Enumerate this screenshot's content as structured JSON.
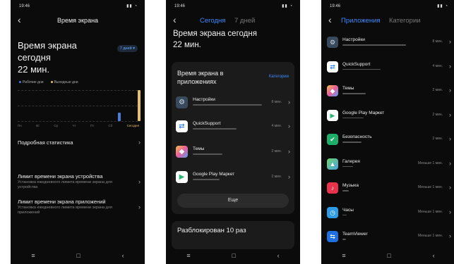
{
  "screen1": {
    "time": "19:46",
    "title": "Время экрана",
    "headline_lines": [
      "Время экрана",
      "сегодня",
      "22 мин."
    ],
    "period_pill": "7 дней ▾",
    "legend_workdays": "Рабочие дни",
    "legend_weekend": "Выходные дни",
    "chart_days": [
      "Пн",
      "Вт",
      "Ср",
      "Чт",
      "Пт",
      "Сб",
      "Сегодня"
    ],
    "chart_data": {
      "type": "bar",
      "categories": [
        "Пн",
        "Вт",
        "Ср",
        "Чт",
        "Пт",
        "Сб",
        "Сегодня"
      ],
      "values": [
        0,
        0,
        0,
        0,
        0,
        6,
        22
      ],
      "colors": [
        "#4a7bd6",
        "#e6c068"
      ]
    },
    "detailed_stats": "Подробная статистика",
    "device_limit_title": "Лимит времени экрана устройства",
    "device_limit_sub": "Установка ежедневного лимита времени экрана для устройства",
    "app_limit_title": "Лимит времени экрана приложений",
    "app_limit_sub": "Установка ежедневного лимита времени экрана для приложений"
  },
  "screen2": {
    "time": "19:46",
    "tab_today": "Сегодня",
    "tab_week": "7 дней",
    "headline_lines": [
      "Время экрана сегодня",
      "22 мин."
    ],
    "card_title_lines": [
      "Время экрана в",
      "приложениях"
    ],
    "categories_link": "Категории",
    "apps": [
      {
        "name": "Настройки",
        "time": "8 мин.",
        "icon": "gear-icon",
        "line": 62
      },
      {
        "name": "QuickSupport",
        "time": "4 мин.",
        "icon": "quicksupport-icon",
        "line": 38
      },
      {
        "name": "Темы",
        "time": "2 мин.",
        "icon": "themes-icon",
        "line": 26
      },
      {
        "name": "Google Play Маркет",
        "time": "2 мин.",
        "icon": "play-store-icon",
        "line": 24
      }
    ],
    "more_button": "Еще",
    "unlocked": "Разблокирован 10 раз"
  },
  "screen3": {
    "time": "19:46",
    "tab_apps": "Приложения",
    "tab_categories": "Категории",
    "apps": [
      {
        "name": "Настройки",
        "time": "8 мин.",
        "icon": "gear-icon",
        "line": 60
      },
      {
        "name": "QuickSupport",
        "time": "4 мин.",
        "icon": "quicksupport-icon",
        "line": 36
      },
      {
        "name": "Темы",
        "time": "2 мин.",
        "icon": "themes-icon",
        "line": 22
      },
      {
        "name": "Google Play Маркет",
        "time": "2 мин.",
        "icon": "play-store-icon",
        "line": 20
      },
      {
        "name": "Безопасность",
        "time": "2 мин.",
        "icon": "security-icon",
        "line": 18
      },
      {
        "name": "Галерея",
        "time": "Меньше 1 мин.",
        "icon": "gallery-icon",
        "line": 10
      },
      {
        "name": "Музыка",
        "time": "Меньше 1 мин.",
        "icon": "music-icon",
        "line": 6
      },
      {
        "name": "Часы",
        "time": "Меньше 1 мин.",
        "icon": "clock-icon",
        "line": 4
      },
      {
        "name": "TeamViewer",
        "time": "Меньше 1 мин.",
        "icon": "teamviewer-icon",
        "line": 3
      }
    ]
  }
}
